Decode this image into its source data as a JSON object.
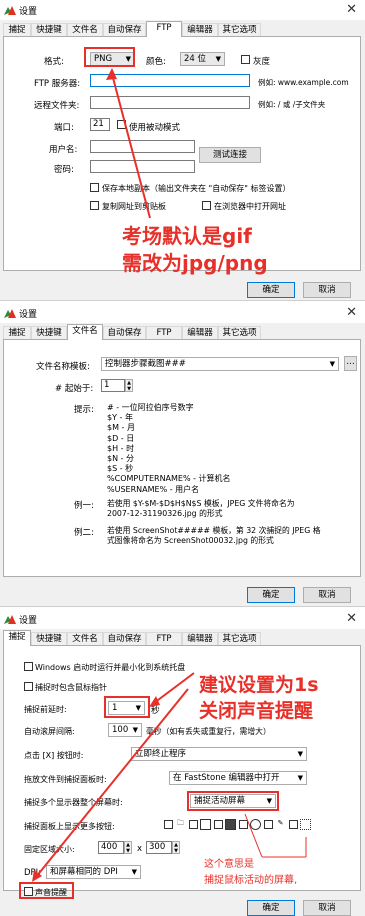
{
  "window_title": "设置",
  "tabs": [
    "捕捉",
    "快捷键",
    "文件名",
    "自动保存",
    "FTP",
    "编辑器",
    "其它选项"
  ],
  "ok_label": "确定",
  "cancel_label": "取消",
  "ftp": {
    "format_label": "格式:",
    "format_value": "PNG",
    "color_label": "颜色:",
    "color_value": "24 位",
    "grayscale_label": "灰度",
    "server_label": "FTP 服务器:",
    "server_example": "例如: www.example.com",
    "remote_label": "远程文件夹:",
    "remote_example": "例如: / 或 /子文件夹",
    "port_label": "端口:",
    "port_value": "21",
    "passive_label": "使用被动模式",
    "user_label": "用户名:",
    "password_label": "密码:",
    "test_button": "测试连接",
    "keep_local_label": "保存本地副本（输出文件夹在 \"自动保存\" 标签设置）",
    "copy_url_label": "复制网址到剪贴板",
    "open_browser_label": "在浏览器中打开网址",
    "annotation_line1": "考场默认是gif",
    "annotation_line2": "需改为jpg/png"
  },
  "filename": {
    "template_label": "文件名称模板:",
    "template_value": "控制器步骤截图###",
    "start_label": "# 起始于:",
    "start_value": "1",
    "hint_label": "提示:",
    "hints": [
      "# - 一位阿拉伯序号数字",
      "$Y - 年",
      "$M - 月",
      "$D - 日",
      "$H - 时",
      "$N - 分",
      "$S - 秒",
      "%COMPUTERNAME% - 计算机名",
      "%USERNAME% - 用户名"
    ],
    "example1_label": "例一:",
    "example1_line1": "若使用 $Y-$M-$D$H$N$S 模板，JPEG 文件将命名为",
    "example1_line2": "2007-12-31190326.jpg 的形式",
    "example2_label": "例二:",
    "example2_line1": "若使用 ScreenShot##### 模板，第 32 次捕捉的 JPEG 格",
    "example2_line2": "式图像将命名为 ScreenShot00032.jpg 的形式"
  },
  "capture": {
    "startup_label": "Windows 启动时运行并最小化到系统托盘",
    "include_cursor_label": "捕捉时包含鼠标指针",
    "delay_label": "捕捉前延时:",
    "delay_value": "1",
    "delay_unit": "秒",
    "scroll_label": "自动滚屏间隔:",
    "scroll_value": "100",
    "scroll_unit": "毫秒（如有丢失或重复行，需增大）",
    "x_button_label": "点击 [X] 按钮时:",
    "x_button_value": "立即终止程序",
    "drag_label": "拖放文件到捕捉面板时:",
    "drag_value": "在 FastStone 编辑器中打开",
    "multi_display_label": "捕捉多个显示器整个屏幕时:",
    "multi_display_value": "捕捉活动屏幕",
    "panel_buttons_label": "捕捉面板上显示更多按钮:",
    "fixed_size_label": "固定区域大小:",
    "fixed_width": "400",
    "fixed_x": "x",
    "fixed_height": "300",
    "dpi_label": "DPI:",
    "dpi_value": "和屏幕相同的 DPI",
    "sound_label": "声音提醒",
    "annotation_line1": "建议设置为1s",
    "annotation_line2": "关闭声音提醒",
    "note_line1": "这个意思是",
    "note_line2": "捕捉鼠标活动的屏幕,"
  },
  "colors": {
    "annotation_red": "#e8302a",
    "focus_blue": "#0078d7"
  }
}
